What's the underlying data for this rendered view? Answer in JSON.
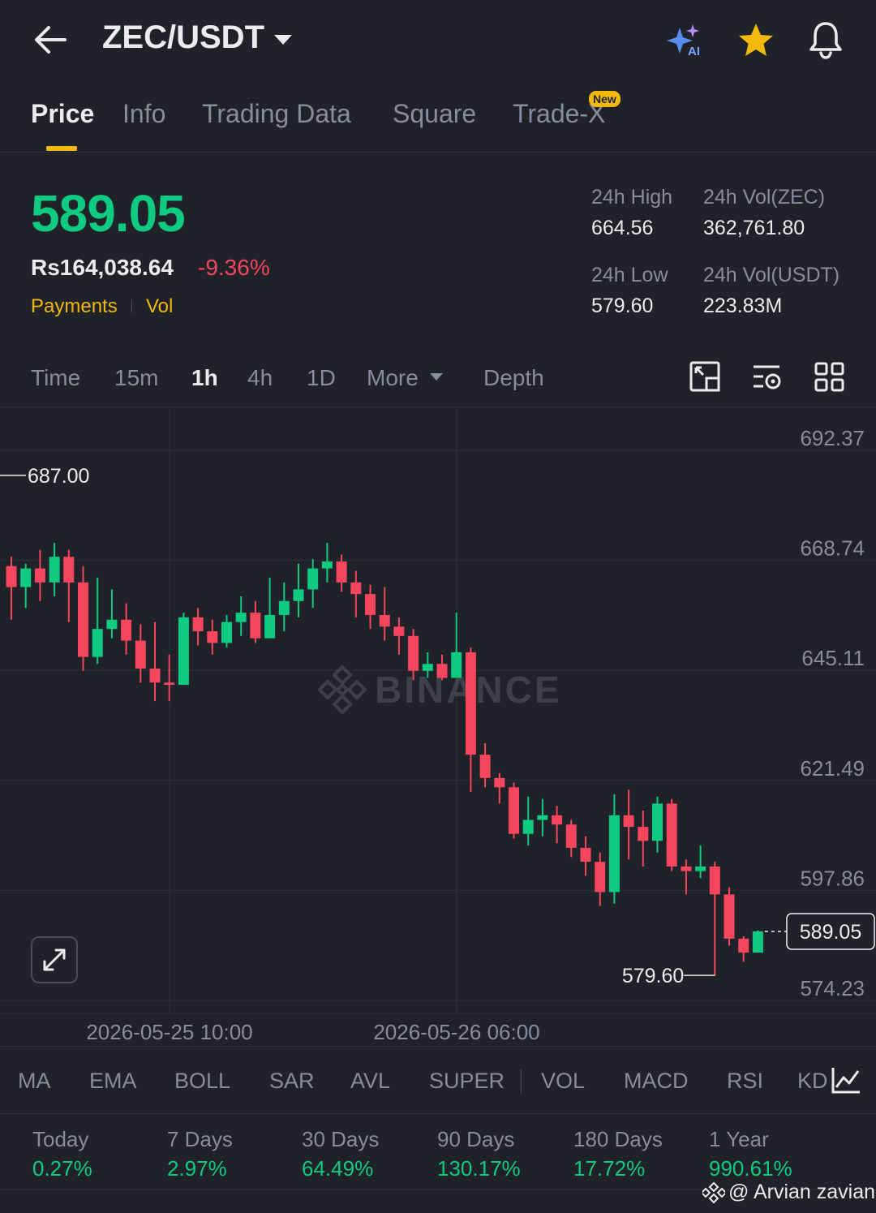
{
  "header": {
    "pair": "ZEC/USDT",
    "ai_label": "AI"
  },
  "tabs": [
    {
      "label": "Price",
      "active": true
    },
    {
      "label": "Info"
    },
    {
      "label": "Trading Data"
    },
    {
      "label": "Square"
    },
    {
      "label": "Trade-X",
      "badge": "New"
    }
  ],
  "price": {
    "last": "589.05",
    "fiat": "Rs164,038.64",
    "change": "-9.36%",
    "tags": [
      "Payments",
      "Vol"
    ]
  },
  "stats": {
    "high_label": "24h High",
    "high": "664.56",
    "low_label": "24h Low",
    "low": "579.60",
    "vol_base_label": "24h Vol(ZEC)",
    "vol_base": "362,761.80",
    "vol_quote_label": "24h Vol(USDT)",
    "vol_quote": "223.83M"
  },
  "intervals": [
    "Time",
    "15m",
    "1h",
    "4h",
    "1D",
    "More",
    "Depth"
  ],
  "active_interval": "1h",
  "indicators": [
    "MA",
    "EMA",
    "BOLL",
    "SAR",
    "AVL",
    "SUPER",
    "VOL",
    "MACD",
    "RSI",
    "KD"
  ],
  "performance": [
    {
      "label": "Today",
      "value": "0.27%"
    },
    {
      "label": "7 Days",
      "value": "2.97%"
    },
    {
      "label": "30 Days",
      "value": "64.49%"
    },
    {
      "label": "90 Days",
      "value": "130.17%"
    },
    {
      "label": "180 Days",
      "value": "17.72%"
    },
    {
      "label": "1 Year",
      "value": "990.61%"
    }
  ],
  "watermark": "@ Arvian zavian",
  "colors": {
    "up": "#0ecb81",
    "down": "#f6465d",
    "accent": "#f0b90b",
    "bg": "#1f2229"
  },
  "chart_data": {
    "type": "candlestick",
    "y_axis_ticks": [
      "692.37",
      "668.74",
      "645.11",
      "621.49",
      "597.86",
      "574.23"
    ],
    "ylim": [
      574.23,
      692.37
    ],
    "x_axis_ticks": [
      "2026-05-25 10:00",
      "2026-05-26 06:00"
    ],
    "watermark": "BINANCE",
    "annotations": {
      "high_marker": "687.00",
      "low_marker": "579.60",
      "last_price": "589.05"
    },
    "candles": [
      {
        "o": 667.5,
        "c": 663.0,
        "h": 669.5,
        "l": 656.0
      },
      {
        "o": 663.0,
        "c": 667.0,
        "h": 668.0,
        "l": 658.5
      },
      {
        "o": 667.0,
        "c": 664.0,
        "h": 671.0,
        "l": 660.0
      },
      {
        "o": 664.0,
        "c": 669.5,
        "h": 672.5,
        "l": 661.0
      },
      {
        "o": 669.5,
        "c": 664.0,
        "h": 671.0,
        "l": 655.5
      },
      {
        "o": 664.0,
        "c": 648.0,
        "h": 667.5,
        "l": 645.0
      },
      {
        "o": 648.0,
        "c": 654.0,
        "h": 665.0,
        "l": 646.5
      },
      {
        "o": 654.0,
        "c": 656.0,
        "h": 662.5,
        "l": 652.0
      },
      {
        "o": 656.0,
        "c": 651.5,
        "h": 659.5,
        "l": 648.5
      },
      {
        "o": 651.5,
        "c": 645.5,
        "h": 655.0,
        "l": 642.5
      },
      {
        "o": 645.5,
        "c": 642.5,
        "h": 655.5,
        "l": 638.5
      },
      {
        "o": 642.5,
        "c": 642.0,
        "h": 648.5,
        "l": 638.5
      },
      {
        "o": 642.0,
        "c": 656.5,
        "h": 657.5,
        "l": 642.0
      },
      {
        "o": 656.5,
        "c": 653.5,
        "h": 658.5,
        "l": 650.5
      },
      {
        "o": 653.5,
        "c": 651.0,
        "h": 656.0,
        "l": 648.5
      },
      {
        "o": 651.0,
        "c": 655.5,
        "h": 657.0,
        "l": 650.0
      },
      {
        "o": 655.5,
        "c": 657.5,
        "h": 661.0,
        "l": 652.5
      },
      {
        "o": 657.5,
        "c": 652.0,
        "h": 660.0,
        "l": 651.0
      },
      {
        "o": 652.0,
        "c": 657.0,
        "h": 665.0,
        "l": 652.0
      },
      {
        "o": 657.0,
        "c": 660.0,
        "h": 664.0,
        "l": 653.5
      },
      {
        "o": 660.0,
        "c": 662.5,
        "h": 668.0,
        "l": 656.5
      },
      {
        "o": 662.5,
        "c": 667.0,
        "h": 669.0,
        "l": 658.5
      },
      {
        "o": 667.0,
        "c": 668.5,
        "h": 672.5,
        "l": 664.0
      },
      {
        "o": 668.5,
        "c": 664.0,
        "h": 670.0,
        "l": 662.0
      },
      {
        "o": 664.0,
        "c": 661.5,
        "h": 666.5,
        "l": 656.5
      },
      {
        "o": 661.5,
        "c": 657.0,
        "h": 663.5,
        "l": 654.0
      },
      {
        "o": 657.0,
        "c": 654.5,
        "h": 663.0,
        "l": 651.5
      },
      {
        "o": 654.5,
        "c": 652.5,
        "h": 656.5,
        "l": 648.5
      },
      {
        "o": 652.5,
        "c": 645.0,
        "h": 654.0,
        "l": 643.0
      },
      {
        "o": 645.0,
        "c": 646.5,
        "h": 649.0,
        "l": 643.5
      },
      {
        "o": 646.5,
        "c": 643.5,
        "h": 648.5,
        "l": 643.0
      },
      {
        "o": 643.5,
        "c": 649.0,
        "h": 657.5,
        "l": 643.5
      },
      {
        "o": 649.0,
        "c": 627.0,
        "h": 650.0,
        "l": 619.0
      },
      {
        "o": 627.0,
        "c": 622.0,
        "h": 629.5,
        "l": 620.0
      },
      {
        "o": 622.0,
        "c": 620.0,
        "h": 623.0,
        "l": 616.5
      },
      {
        "o": 620.0,
        "c": 610.0,
        "h": 621.0,
        "l": 609.0
      },
      {
        "o": 610.0,
        "c": 613.0,
        "h": 618.0,
        "l": 607.5
      },
      {
        "o": 613.0,
        "c": 614.0,
        "h": 617.5,
        "l": 609.5
      },
      {
        "o": 614.0,
        "c": 612.0,
        "h": 616.0,
        "l": 608.0
      },
      {
        "o": 612.0,
        "c": 607.0,
        "h": 613.0,
        "l": 605.0
      },
      {
        "o": 607.0,
        "c": 604.0,
        "h": 609.5,
        "l": 601.0
      },
      {
        "o": 604.0,
        "c": 597.5,
        "h": 606.0,
        "l": 594.5
      },
      {
        "o": 597.5,
        "c": 614.0,
        "h": 618.5,
        "l": 595.0
      },
      {
        "o": 614.0,
        "c": 611.5,
        "h": 619.5,
        "l": 604.5
      },
      {
        "o": 611.5,
        "c": 608.5,
        "h": 615.0,
        "l": 603.0
      },
      {
        "o": 608.5,
        "c": 616.5,
        "h": 618.0,
        "l": 606.0
      },
      {
        "o": 616.5,
        "c": 603.0,
        "h": 617.5,
        "l": 602.0
      },
      {
        "o": 603.0,
        "c": 602.0,
        "h": 604.5,
        "l": 597.0
      },
      {
        "o": 602.0,
        "c": 603.0,
        "h": 607.5,
        "l": 600.5
      },
      {
        "o": 603.0,
        "c": 597.0,
        "h": 604.0,
        "l": 579.6
      },
      {
        "o": 597.0,
        "c": 587.5,
        "h": 598.5,
        "l": 586.0
      },
      {
        "o": 587.5,
        "c": 584.5,
        "h": 588.0,
        "l": 582.5
      },
      {
        "o": 584.5,
        "c": 589.05,
        "h": 589.3,
        "l": 584.5
      }
    ]
  }
}
